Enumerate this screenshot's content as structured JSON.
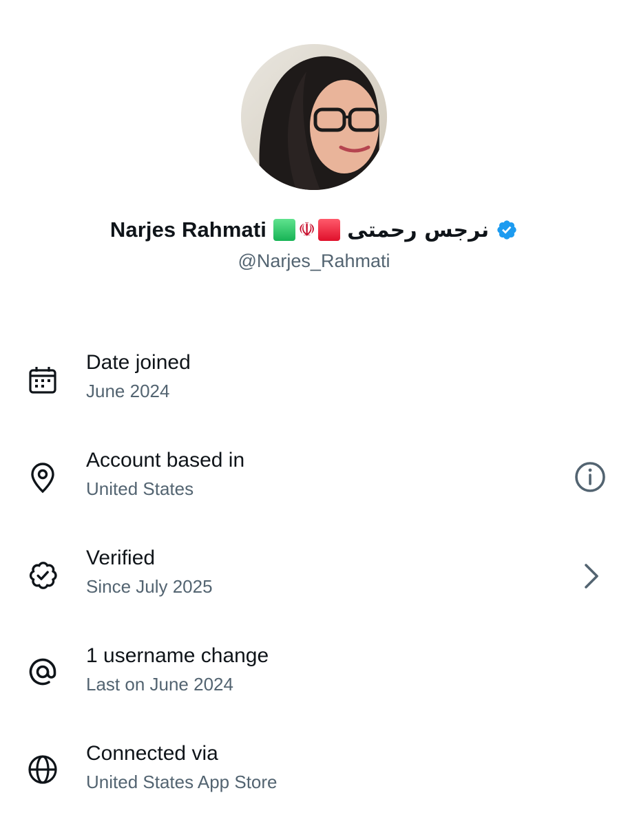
{
  "profile": {
    "display_name": "Narjes Rahmati",
    "flag_emblem": "☫",
    "persian_name": "نرجس رحمتی",
    "handle": "@Narjes_Rahmati",
    "verified_badge_icon": "verified-badge-icon",
    "accent_color": "#1d9bf0"
  },
  "details": [
    {
      "icon": "calendar-icon",
      "title": "Date joined",
      "subtitle": "June 2024"
    },
    {
      "icon": "location-pin-icon",
      "title": "Account based in",
      "subtitle": "United States",
      "action_icon": "info-icon"
    },
    {
      "icon": "verified-outline-icon",
      "title": "Verified",
      "subtitle": "Since July 2025",
      "action_icon": "chevron-right-icon"
    },
    {
      "icon": "at-sign-icon",
      "title": "1 username change",
      "subtitle": "Last on June 2024"
    },
    {
      "icon": "globe-icon",
      "title": "Connected via",
      "subtitle": "United States App Store"
    }
  ],
  "colors": {
    "text_primary": "#0f1419",
    "text_secondary": "#536471"
  }
}
